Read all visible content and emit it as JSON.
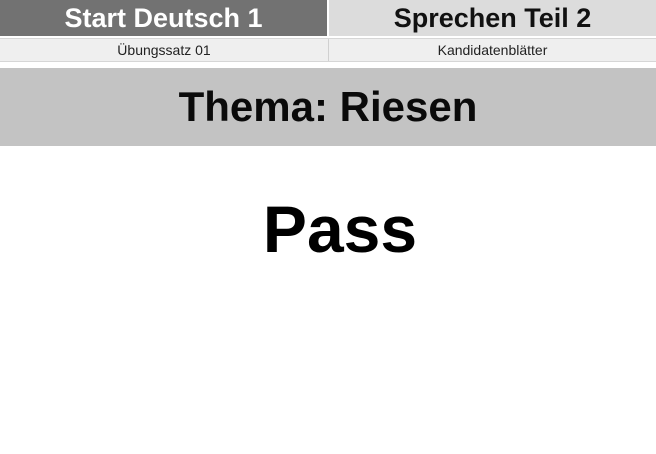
{
  "header": {
    "left_title": "Start Deutsch 1",
    "right_title": "Sprechen Teil 2"
  },
  "subheader": {
    "left_label": "Übungssatz 01",
    "right_label": "Kandidatenblätter"
  },
  "theme": {
    "label": "Thema: Riesen"
  },
  "card": {
    "word": "Pass"
  },
  "colors": {
    "header_left_bg": "#727272",
    "header_right_bg": "#dcdcdc",
    "theme_band_bg": "#c3c3c3"
  }
}
